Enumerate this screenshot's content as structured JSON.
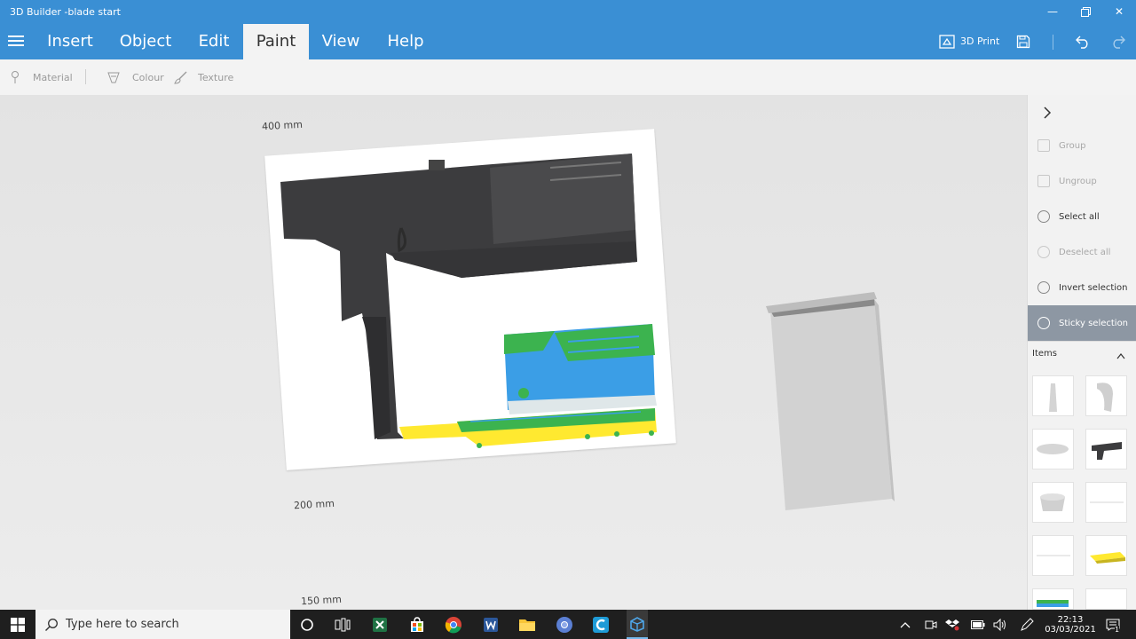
{
  "window": {
    "title": "3D Builder -blade start"
  },
  "menu": {
    "tabs": [
      {
        "label": "Insert"
      },
      {
        "label": "Object"
      },
      {
        "label": "Edit"
      },
      {
        "label": "Paint"
      },
      {
        "label": "View"
      },
      {
        "label": "Help"
      }
    ],
    "print_label": "3D Print"
  },
  "toolbar": {
    "material_label": "Material",
    "colour_label": "Colour",
    "texture_label": "Texture"
  },
  "viewport": {
    "measure_top": "400 mm",
    "measure_mid": "200 mm",
    "measure_bottom": "150 mm"
  },
  "panel": {
    "commands": [
      {
        "label": "Group"
      },
      {
        "label": "Ungroup"
      },
      {
        "label": "Select all"
      },
      {
        "label": "Deselect all"
      },
      {
        "label": "Invert selection"
      },
      {
        "label": "Sticky selection"
      }
    ],
    "items_label": "Items"
  },
  "taskbar": {
    "search_placeholder": "Type here to search",
    "time": "22:13",
    "date": "03/03/2021",
    "notification_count": "1"
  },
  "colors": {
    "accent": "#3a8fd4",
    "model_blue": "#3b9ee6",
    "model_green": "#3cb34f",
    "model_yellow": "#ffe930"
  }
}
